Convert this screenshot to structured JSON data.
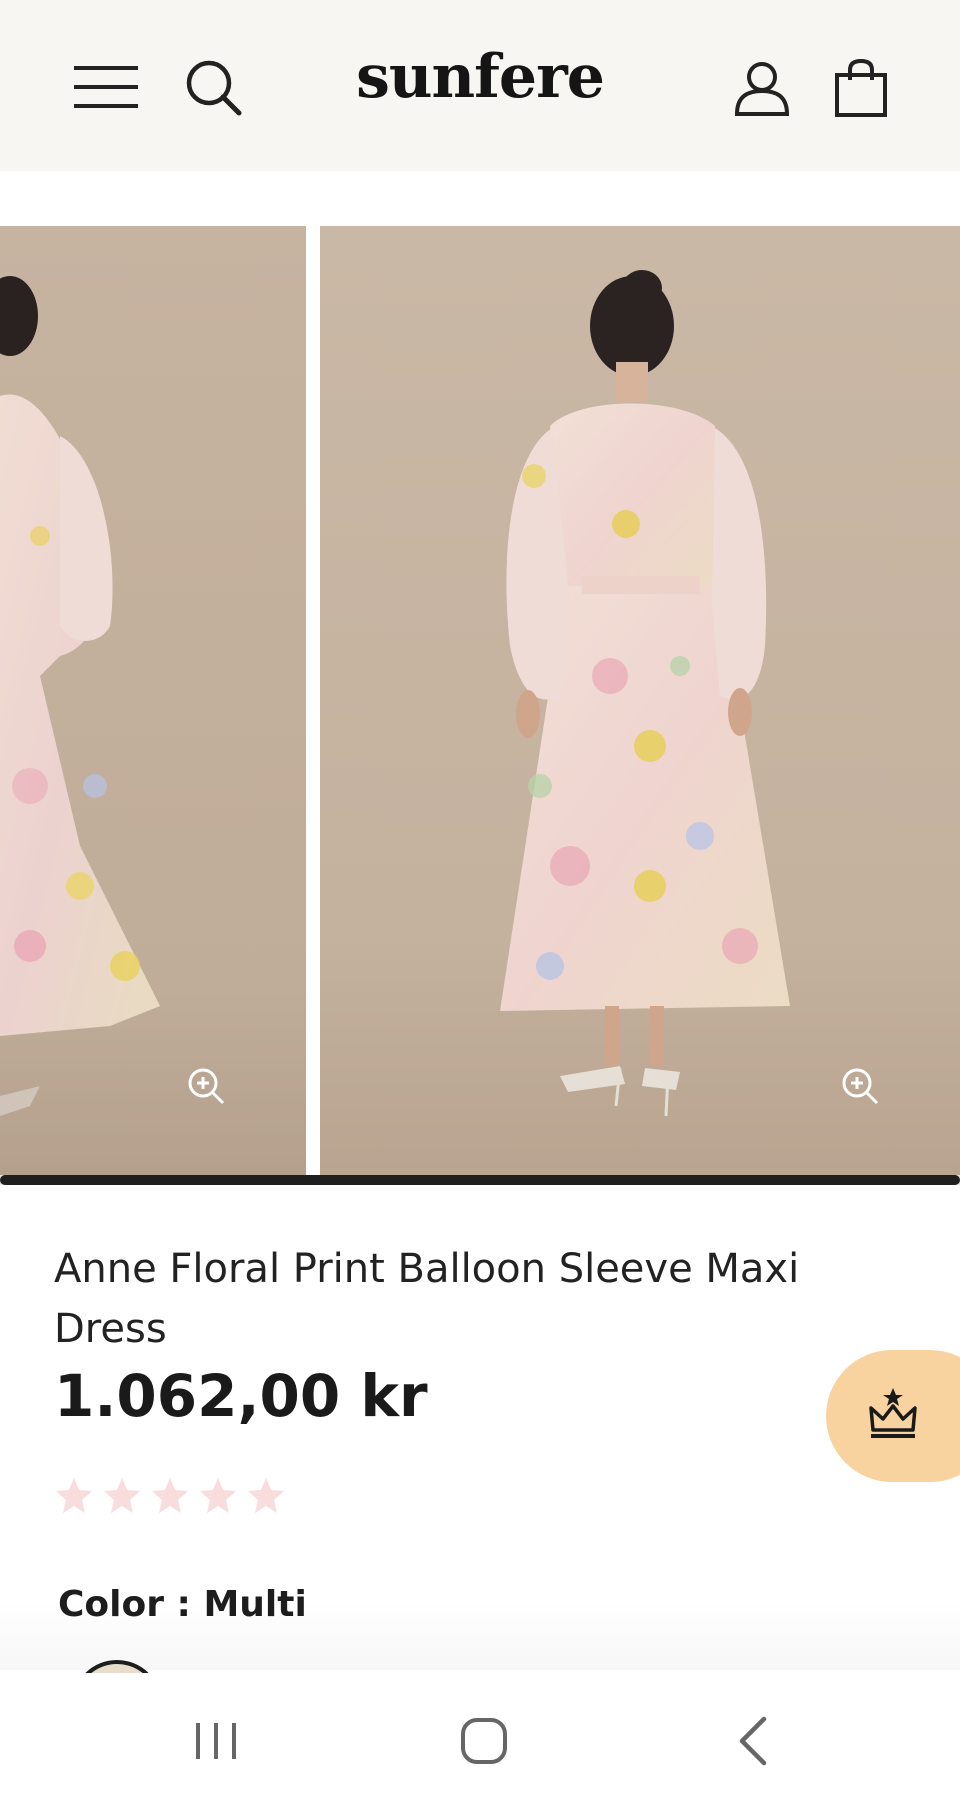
{
  "header": {
    "logo": "sunfere",
    "menu_icon": "hamburger-menu-icon",
    "search_icon": "search-icon",
    "account_icon": "user-icon",
    "cart_icon": "shopping-bag-icon"
  },
  "gallery": {
    "images": [
      "product-photo-front-side",
      "product-photo-back"
    ],
    "zoom_icon": "zoom-in-icon",
    "progress": 1.0
  },
  "product": {
    "title": "Anne Floral Print Balloon Sleeve Maxi Dress",
    "price": "1.062,00 kr",
    "rating": 0,
    "rating_max": 5,
    "color_label": "Color",
    "color_separator": " : ",
    "color_value": "Multi"
  },
  "loyalty": {
    "icon": "crown-icon",
    "color": "#f8d3a0"
  },
  "colors": {
    "header_bg": "#f7f6f3",
    "star_empty": "#f9dcdc",
    "text": "#1c1c1c"
  },
  "system_nav": {
    "recents_icon": "recent-apps-icon",
    "home_icon": "home-icon",
    "back_icon": "back-icon"
  }
}
